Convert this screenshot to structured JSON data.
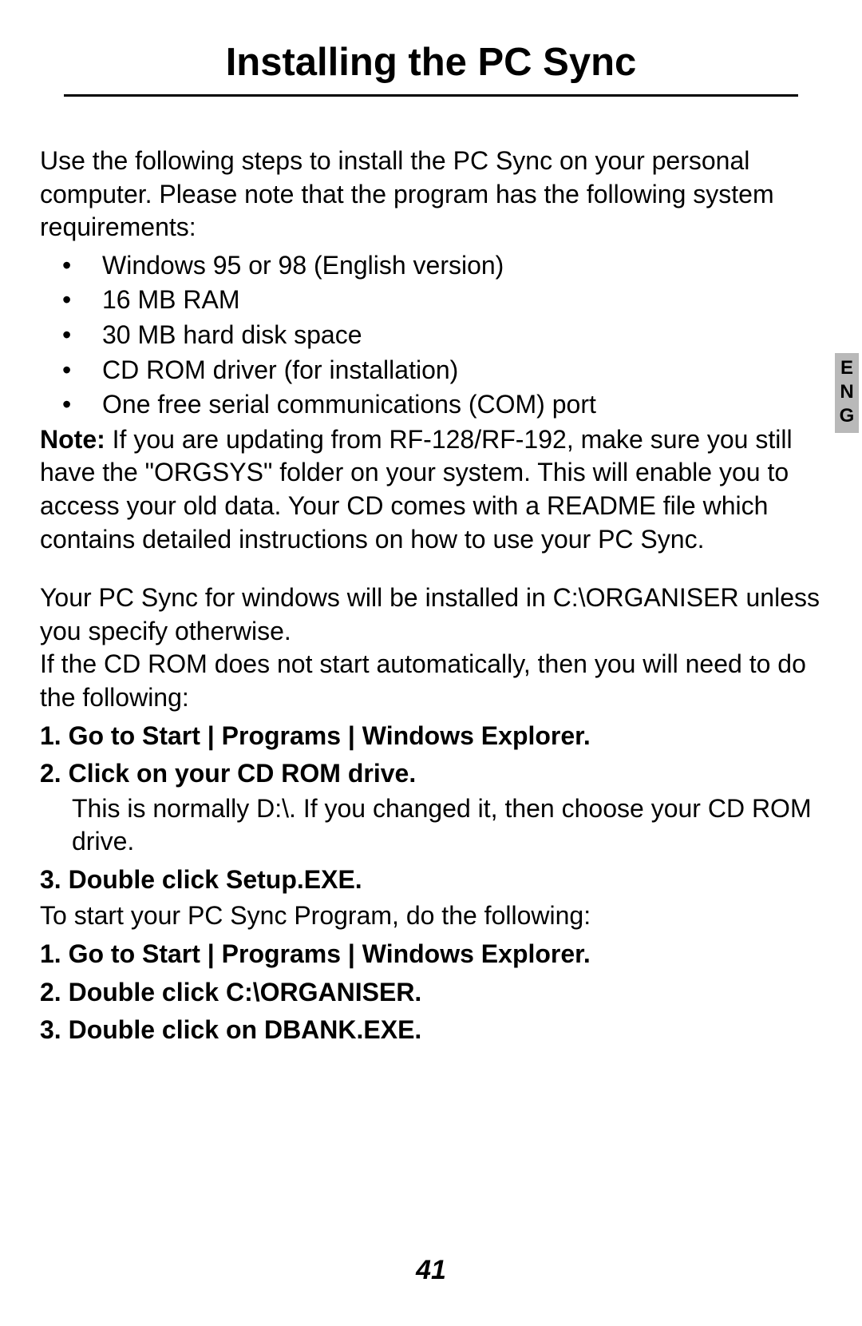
{
  "title": "Installing the PC Sync",
  "intro": "Use the following steps to install the PC Sync on your personal computer. Please note that the program has the following system requirements:",
  "requirements": [
    "Windows 95 or 98 (English version)",
    "16 MB RAM",
    "30 MB hard disk space",
    "CD ROM driver (for installation)",
    "One free serial communications (COM) port"
  ],
  "note_label": "Note:",
  "note_body": "  If you are updating from RF-128/RF-192, make sure you still have the \"ORGSYS\" folder on your system.  This will enable you to access your old data.  Your CD comes with a README file which contains detailed instructions on how to use your PC Sync.",
  "install_loc": "Your PC Sync for windows will be installed in C:\\ORGANISER  unless you specify otherwise.",
  "cd_instr": "If the CD ROM does not start automatically, then you will need to do the following:",
  "steps_a": {
    "s1": "1. Go to Start | Programs | Windows Explorer.",
    "s2": "2. Click on your CD ROM drive.",
    "s2_sub": "This is normally D:\\. If you changed it, then choose your CD ROM drive.",
    "s3": "3. Double click Setup.EXE."
  },
  "start_instr": "To start your PC Sync Program, do the following:",
  "steps_b": {
    "s1": "1. Go to Start | Programs | Windows Explorer.",
    "s2": "2. Double click C:\\ORGANISER.",
    "s3": "3. Double click on DBANK.EXE."
  },
  "lang_tab": "ENG",
  "page_number": "41"
}
